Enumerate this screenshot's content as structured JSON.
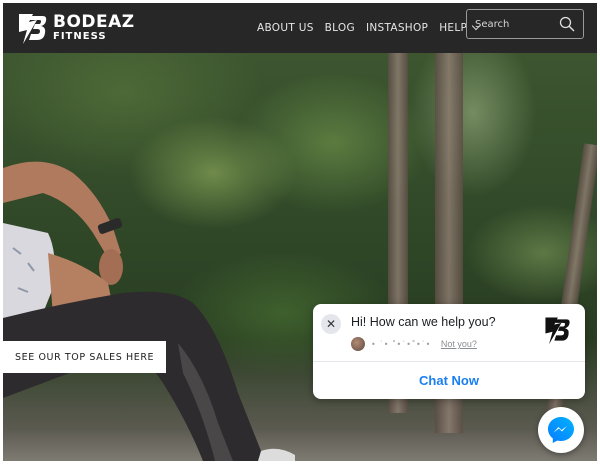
{
  "brand": {
    "line1": "BODEAZ",
    "line2": "FITNESS"
  },
  "nav": {
    "items": [
      {
        "label": "ABOUT US"
      },
      {
        "label": "BLOG"
      },
      {
        "label": "INSTASHOP"
      },
      {
        "label": "HELP"
      }
    ]
  },
  "search": {
    "placeholder": "Search"
  },
  "hero": {
    "cta_label": "SEE OUR TOP SALES HERE"
  },
  "chat": {
    "greeting": "Hi! How can we help you?",
    "user_name": "• ˙• ˚•˙•˚•˙•",
    "not_you": "Not you?",
    "cta": "Chat Now"
  },
  "colors": {
    "header_bg": "#272727",
    "chat_accent": "#1a7ef2",
    "messenger_blue": "#0a7cff"
  },
  "icons": [
    "logo-icon",
    "search-icon",
    "chevron-down-icon",
    "close-icon",
    "messenger-icon"
  ]
}
